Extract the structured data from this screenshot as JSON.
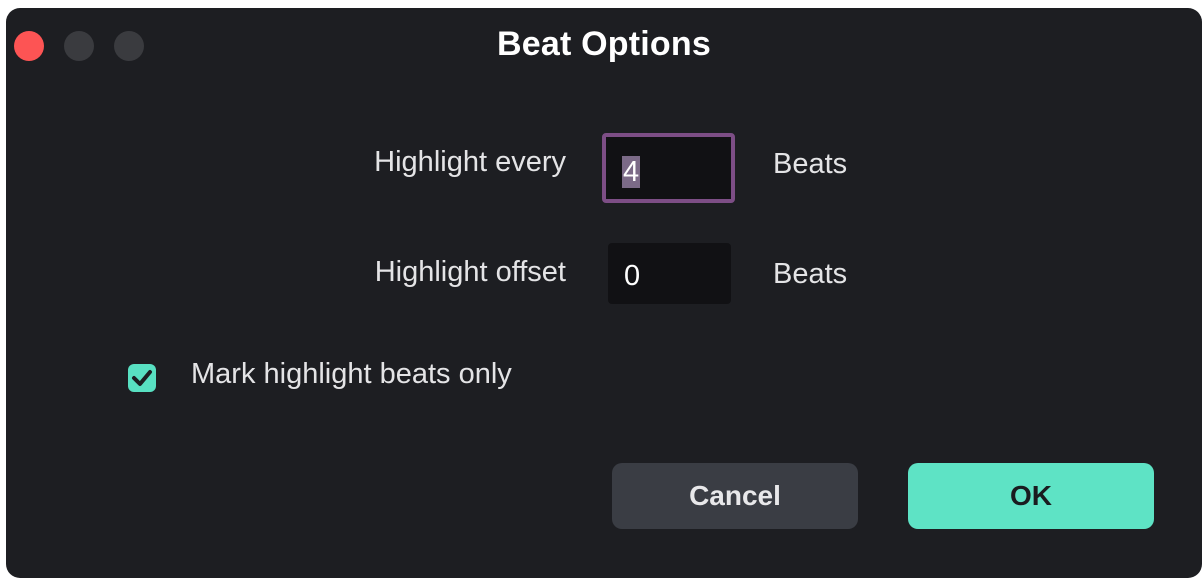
{
  "window": {
    "title": "Beat Options"
  },
  "highlight_every": {
    "label": "Highlight every",
    "value": "4",
    "unit": "Beats"
  },
  "highlight_offset": {
    "label": "Highlight offset",
    "value": "0",
    "unit": "Beats"
  },
  "mark_highlight": {
    "label": "Mark highlight beats only",
    "checked": true
  },
  "buttons": {
    "cancel_label": "Cancel",
    "ok_label": "OK"
  },
  "colors": {
    "accent": "#5ee3c5",
    "focus_border": "#7d4e86",
    "close_button": "#fd5454"
  },
  "icons": {
    "checkbox": "checkmark-icon"
  }
}
